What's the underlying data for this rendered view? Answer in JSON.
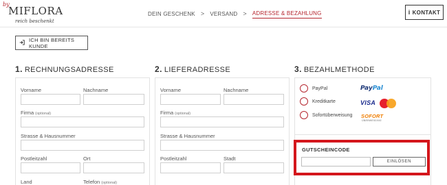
{
  "brand": {
    "by": "by",
    "name": "MIFLORA",
    "tagline": "reich beschenkt"
  },
  "steps": {
    "items": [
      "DEIN GESCHENK",
      "VERSAND",
      "ADRESSE & BEZAHLUNG"
    ],
    "separator": ">",
    "active_index": 2
  },
  "contact": {
    "label": "KONTAKT",
    "icon": "info-icon",
    "icon_glyph": "i"
  },
  "existing_customer": {
    "label": "ICH BIN BEREITS KUNDE",
    "icon": "login-icon"
  },
  "sections": [
    {
      "number": "1.",
      "title": "RECHNUNGSADRESSE"
    },
    {
      "number": "2.",
      "title": "LIEFERADRESSE"
    },
    {
      "number": "3.",
      "title": "BEZAHLMETHODE"
    }
  ],
  "billing": {
    "first_name": "Vorname",
    "last_name": "Nachname",
    "company": "Firma",
    "company_opt": "(optional)",
    "street": "Strasse & Hausnummer",
    "zip": "Postleitzahl",
    "city": "Ort",
    "country": "Land",
    "phone": "Telefon",
    "phone_opt": "(optional)"
  },
  "shipping": {
    "first_name": "Vorname",
    "last_name": "Nachname",
    "company": "Firma",
    "company_opt": "(optional)",
    "street": "Strasse & Hausnummer",
    "zip": "Postleitzahl",
    "city": "Stadt"
  },
  "payment": {
    "methods": [
      {
        "label": "PayPal",
        "logo": "paypal-logo"
      },
      {
        "label": "Kreditkarte",
        "logo": "visa-mastercard-logo"
      },
      {
        "label": "Sofortüberweisung",
        "logo": "sofort-logo"
      }
    ],
    "paypal_logo": {
      "part1": "Pay",
      "part2": "Pal"
    },
    "visa_logo": "VISA",
    "sofort_logo": "SOFORT",
    "sofort_sub": "ÜBERWEISUNG"
  },
  "voucher": {
    "title": "GUTSCHEINCODE",
    "input_value": "",
    "button_label": "EINLÖSEN",
    "highlight_color": "#d4161c"
  },
  "colors": {
    "accent": "#b5252e",
    "text": "#333333",
    "border": "#e2e2e2"
  }
}
